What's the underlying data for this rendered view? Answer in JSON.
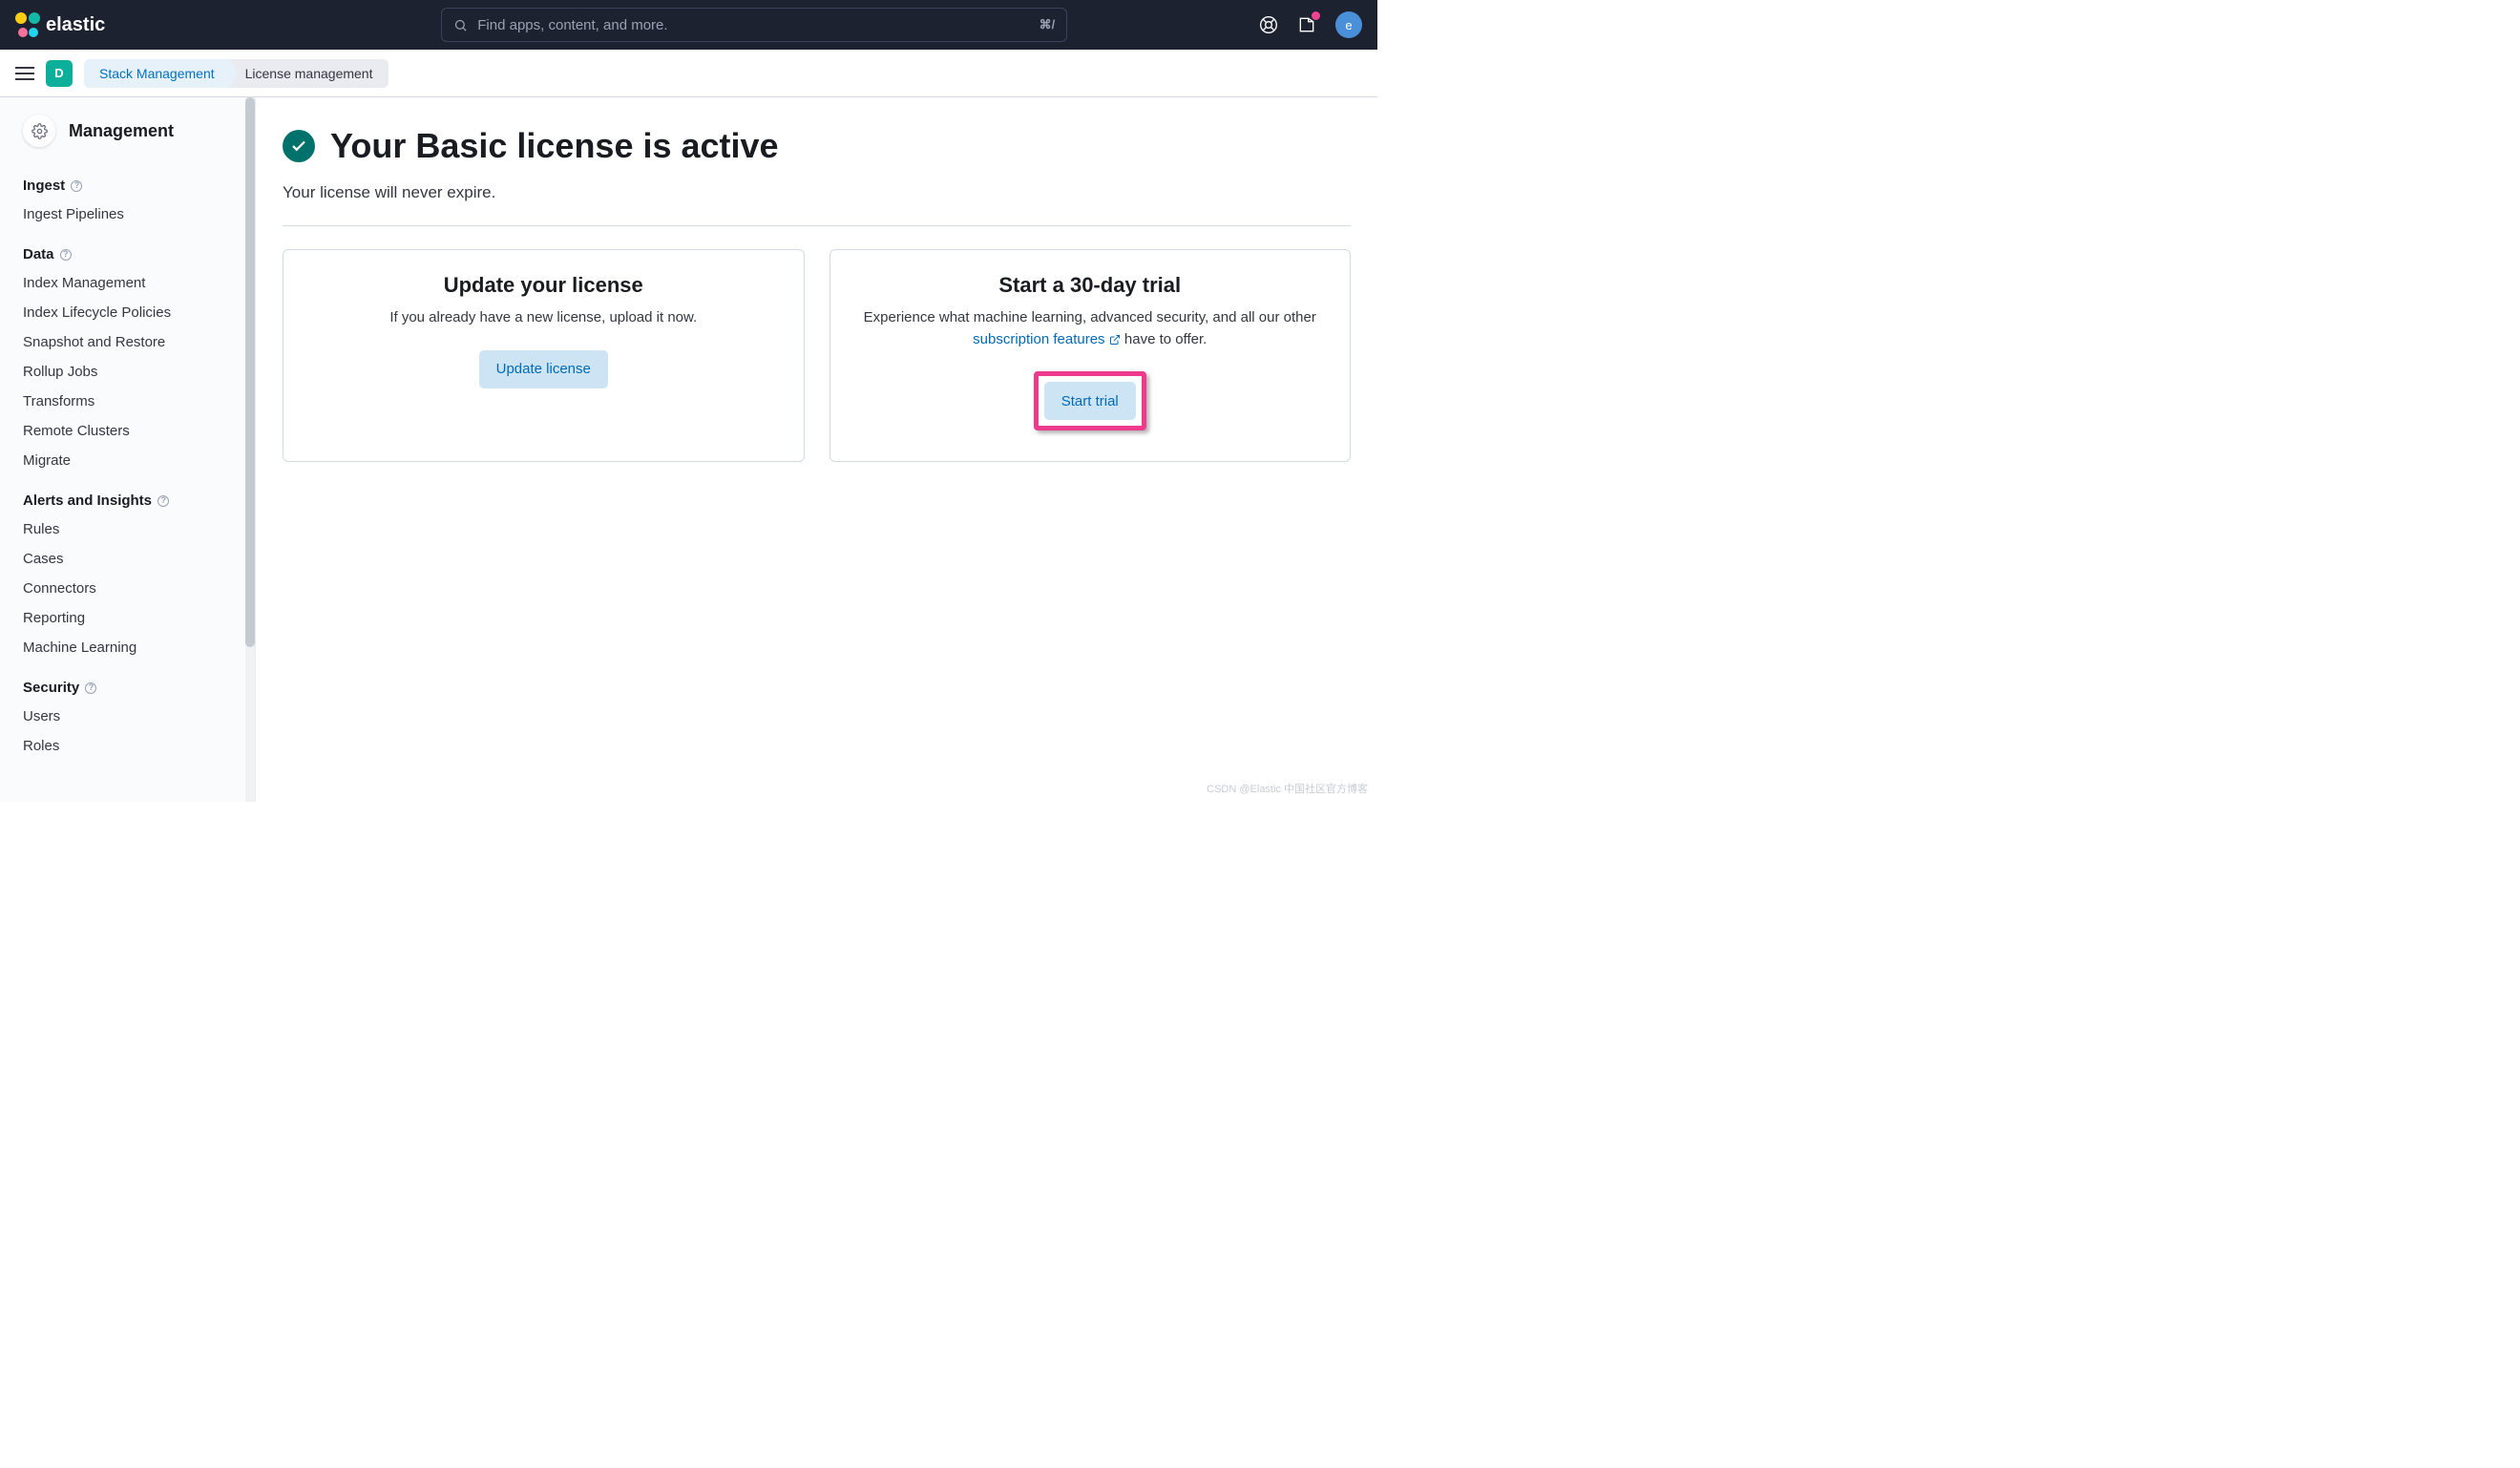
{
  "header": {
    "brand": "elastic",
    "search_placeholder": "Find apps, content, and more.",
    "search_shortcut": "⌘/",
    "avatar_letter": "e"
  },
  "subheader": {
    "space_letter": "D",
    "crumb1": "Stack Management",
    "crumb2": "License management"
  },
  "sidebar": {
    "title": "Management",
    "sections": [
      {
        "heading": "Ingest",
        "items": [
          "Ingest Pipelines"
        ]
      },
      {
        "heading": "Data",
        "items": [
          "Index Management",
          "Index Lifecycle Policies",
          "Snapshot and Restore",
          "Rollup Jobs",
          "Transforms",
          "Remote Clusters",
          "Migrate"
        ]
      },
      {
        "heading": "Alerts and Insights",
        "items": [
          "Rules",
          "Cases",
          "Connectors",
          "Reporting",
          "Machine Learning"
        ]
      },
      {
        "heading": "Security",
        "items": [
          "Users",
          "Roles"
        ]
      }
    ]
  },
  "main": {
    "title": "Your Basic license is active",
    "subtitle": "Your license will never expire.",
    "card1": {
      "heading": "Update your license",
      "text": "If you already have a new license, upload it now.",
      "button": "Update license"
    },
    "card2": {
      "heading": "Start a 30-day trial",
      "text_pre": "Experience what machine learning, advanced security, and all our other ",
      "link": "subscription features",
      "text_post": " have to offer.",
      "button": "Start trial"
    }
  },
  "watermark": "CSDN @Elastic 中国社区官方博客"
}
